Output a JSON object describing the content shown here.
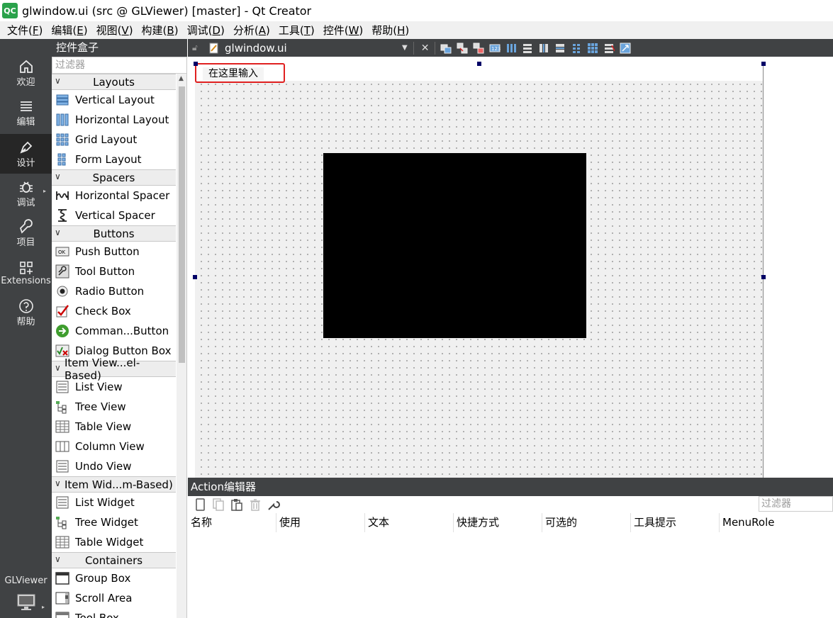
{
  "window": {
    "title": "glwindow.ui (src @ GLViewer) [master] - Qt Creator",
    "logo": "QC"
  },
  "menubar": [
    {
      "label": "文件(",
      "key": "F",
      "tail": ")"
    },
    {
      "label": "编辑(",
      "key": "E",
      "tail": ")"
    },
    {
      "label": "视图(",
      "key": "V",
      "tail": ")"
    },
    {
      "label": "构建(",
      "key": "B",
      "tail": ")"
    },
    {
      "label": "调试(",
      "key": "D",
      "tail": ")"
    },
    {
      "label": "分析(",
      "key": "A",
      "tail": ")"
    },
    {
      "label": "工具(",
      "key": "T",
      "tail": ")"
    },
    {
      "label": "控件(",
      "key": "W",
      "tail": ")"
    },
    {
      "label": "帮助(",
      "key": "H",
      "tail": ")"
    }
  ],
  "modes": {
    "welcome": {
      "label": "欢迎",
      "icon": "home-icon"
    },
    "edit": {
      "label": "编辑",
      "icon": "edit-lines-icon"
    },
    "design": {
      "label": "设计",
      "icon": "pen-icon"
    },
    "debug": {
      "label": "调试",
      "icon": "bug-icon"
    },
    "projects": {
      "label": "项目",
      "icon": "wrench-icon"
    },
    "extensions": {
      "label": "Extensions",
      "icon": "extensions-icon"
    },
    "help": {
      "label": "帮助",
      "icon": "help-icon"
    },
    "project_name": "GLViewer"
  },
  "widgetbox": {
    "title": "控件盒子",
    "filter_placeholder": "过滤器",
    "cats": {
      "layouts": "Layouts",
      "spacers": "Spacers",
      "buttons": "Buttons",
      "itemviews": "Item View...el-Based)",
      "itemwidgets": "Item Wid...m-Based)",
      "containers": "Containers"
    },
    "items": {
      "vertical_layout": "Vertical Layout",
      "horizontal_layout": "Horizontal Layout",
      "grid_layout": "Grid Layout",
      "form_layout": "Form Layout",
      "horizontal_spacer": "Horizontal Spacer",
      "vertical_spacer": "Vertical Spacer",
      "push_button": "Push Button",
      "tool_button": "Tool Button",
      "radio_button": "Radio Button",
      "check_box": "Check Box",
      "command_link_button": "Comman...Button",
      "dialog_button_box": "Dialog Button Box",
      "list_view": "List View",
      "tree_view": "Tree View",
      "table_view": "Table View",
      "column_view": "Column View",
      "undo_view": "Undo View",
      "list_widget": "List Widget",
      "tree_widget": "Tree Widget",
      "table_widget": "Table Widget",
      "group_box": "Group Box",
      "scroll_area": "Scroll Area",
      "tool_box": "Tool Box"
    }
  },
  "editor": {
    "file_name": "glwindow.ui",
    "form_menu_placeholder": "在这里输入"
  },
  "action_editor": {
    "title": "Action编辑器",
    "filter_placeholder": "过滤器",
    "columns": [
      "名称",
      "使用",
      "文本",
      "快捷方式",
      "可选的",
      "工具提示",
      "MenuRole"
    ]
  },
  "colors": {
    "dark_panel": "#404244",
    "active_mode": "#262626",
    "highlight": "#e02020",
    "handle": "#000066"
  }
}
